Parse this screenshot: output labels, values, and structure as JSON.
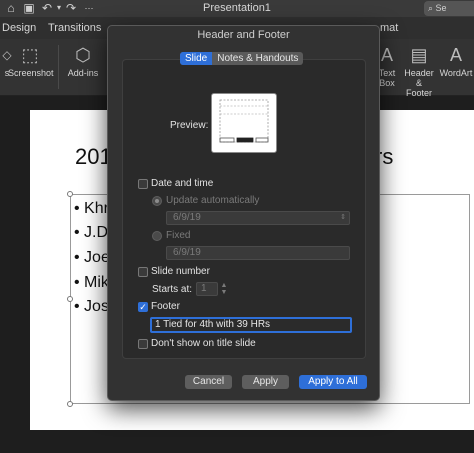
{
  "titlebar": {
    "doc_title": "Presentation1",
    "search_label": "Se"
  },
  "tabs": [
    {
      "label": "Design"
    },
    {
      "label": "Transitions"
    },
    {
      "label": "mat"
    }
  ],
  "ribbon": {
    "screenshot_label": "Screenshot",
    "addins_label": "Add-ins",
    "textbox_label1": "Text",
    "textbox_label2": "Box",
    "headerfooter_label1": "Header &",
    "headerfooter_label2": "Footer",
    "wordart_label": "WordArt"
  },
  "slide": {
    "title_left": "201",
    "title_right": "rs",
    "bullets": [
      "Khr",
      "J.D.",
      "Joe",
      "Mik",
      "Jos"
    ]
  },
  "dialog": {
    "title": "Header and Footer",
    "tabs": [
      {
        "label": "Slide",
        "active": true
      },
      {
        "label": "Notes & Handouts",
        "active": false
      }
    ],
    "preview_label": "Preview:",
    "date_time": {
      "label": "Date and time",
      "checked": false,
      "update_auto_label": "Update automatically",
      "auto_value": "6/9/19",
      "fixed_label": "Fixed",
      "fixed_value": "6/9/19"
    },
    "slide_number": {
      "label": "Slide number",
      "checked": false,
      "starts_at_label": "Starts at:",
      "starts_at_value": "1"
    },
    "footer": {
      "label": "Footer",
      "checked": true,
      "value": "1 Tied for 4th with 39 HRs"
    },
    "dont_show": {
      "label": "Don't show on title slide",
      "checked": false
    },
    "buttons": {
      "cancel": "Cancel",
      "apply": "Apply",
      "apply_all": "Apply to All"
    }
  },
  "colors": {
    "accent": "#2e6fd8",
    "dialog_bg": "#323232",
    "panel_bg": "#2a2a2a"
  }
}
